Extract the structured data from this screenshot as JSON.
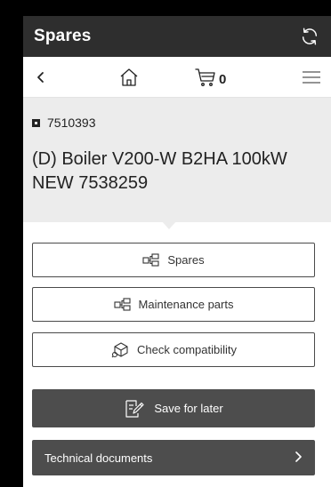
{
  "app": {
    "title": "Spares"
  },
  "nav": {
    "cart_count": "0"
  },
  "product": {
    "code": "7510393",
    "name": "(D) Boiler V200-W B2HA 100kW NEW 7538259"
  },
  "actions": {
    "spares_label": "Spares",
    "maintenance_label": "Maintenance parts",
    "compat_label": "Check compatibility",
    "save_label": "Save for later",
    "tech_docs_label": "Technical documents"
  },
  "icons": {
    "refresh": "refresh-icon",
    "back": "chevron-left-icon",
    "home": "home-icon",
    "cart": "cart-icon",
    "menu": "hamburger-menu-icon",
    "parts": "parts-tree-icon",
    "compat": "compatibility-box-icon",
    "save": "edit-note-icon",
    "forward": "chevron-right-icon"
  },
  "colors": {
    "titlebar": "#2e2e2e",
    "header_bg": "#ececec",
    "dark_button": "#4d4d4d"
  }
}
